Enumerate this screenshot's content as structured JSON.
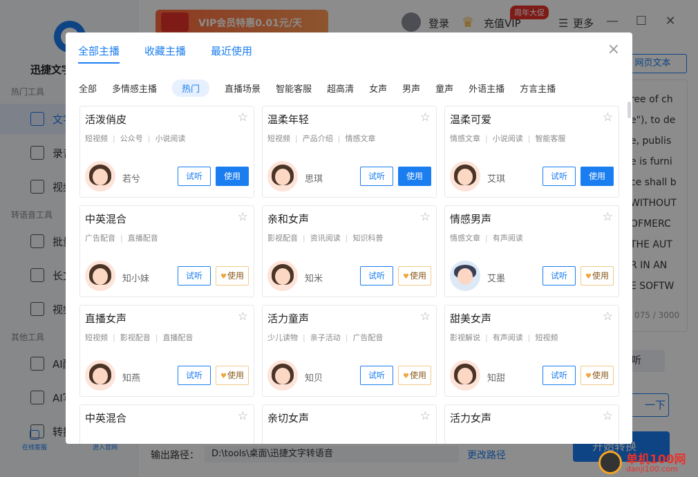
{
  "app": {
    "name": "迅捷文字转语音"
  },
  "sidebar": {
    "sections": [
      "热门工具",
      "转语音工具",
      "其他工具"
    ],
    "items": [
      {
        "label": "文字转语音"
      },
      {
        "label": "录音转文字"
      },
      {
        "label": "视频转文字"
      },
      {
        "label": "批量转换"
      },
      {
        "label": "长文本"
      },
      {
        "label": "视频配音"
      },
      {
        "label": "AI配音"
      },
      {
        "label": "AI写作"
      },
      {
        "label": "转换记录"
      }
    ],
    "bottom_links": [
      "在线客服",
      "进入官网"
    ]
  },
  "topbar": {
    "vip_banner": "VIP会员特惠0.01元/天",
    "login": "登录",
    "recharge_vip": "充值VIP",
    "anniversary": "周年大促",
    "more": "更多",
    "minimize": "—",
    "maximize": "☐",
    "close": "✕"
  },
  "main": {
    "web_text_button": "网页文本",
    "text_lines": [
      "ree of ch",
      "e\"), to de",
      "e, publis",
      "e is furni",
      "ce shall b",
      "WITHOUT",
      "OFMERC",
      "THE AUT",
      "R IN AN",
      "E SOFTW"
    ],
    "counter": "075 / 3000",
    "listen_label": "听",
    "next_label": "一下",
    "start_convert": "开始转换",
    "output_label": "输出路径：",
    "output_path": "D:\\tools\\桌面\\迅捷文字转语音",
    "change_path": "更改路径"
  },
  "modal": {
    "tabs": [
      "全部主播",
      "收藏主播",
      "最近使用"
    ],
    "active_tab": 0,
    "close_icon": "×",
    "filters": [
      "全部",
      "多情感主播",
      "热门",
      "直播场景",
      "智能客服",
      "超高清",
      "女声",
      "男声",
      "童声",
      "外语主播",
      "方言主播"
    ],
    "active_filter": 2,
    "try_label": "试听",
    "use_label": "使用",
    "cards": [
      {
        "title": "活泼俏皮",
        "tags": [
          "短视频",
          "公众号",
          "小说阅读"
        ],
        "speaker": "若兮",
        "vip": false,
        "gender": "f"
      },
      {
        "title": "温柔年轻",
        "tags": [
          "短视频",
          "产品介绍",
          "情感文章"
        ],
        "speaker": "思琪",
        "vip": false,
        "gender": "f"
      },
      {
        "title": "温柔可爱",
        "tags": [
          "情感文章",
          "小说阅读",
          "智能客服"
        ],
        "speaker": "艾琪",
        "vip": false,
        "gender": "f"
      },
      {
        "title": "中英混合",
        "tags": [
          "广告配音",
          "直播配音"
        ],
        "speaker": "知小妹",
        "vip": true,
        "gender": "f"
      },
      {
        "title": "亲和女声",
        "tags": [
          "影视配音",
          "资讯阅读",
          "知识科普"
        ],
        "speaker": "知米",
        "vip": true,
        "gender": "f"
      },
      {
        "title": "情感男声",
        "tags": [
          "情感文章",
          "有声阅读"
        ],
        "speaker": "艾墨",
        "vip": true,
        "gender": "m"
      },
      {
        "title": "直播女声",
        "tags": [
          "短视频",
          "影视配音",
          "直播配音"
        ],
        "speaker": "知燕",
        "vip": true,
        "gender": "f"
      },
      {
        "title": "活力童声",
        "tags": [
          "少儿读物",
          "亲子活动",
          "广告配音"
        ],
        "speaker": "知贝",
        "vip": true,
        "gender": "f"
      },
      {
        "title": "甜美女声",
        "tags": [
          "影视解说",
          "有声阅读",
          "短视频"
        ],
        "speaker": "知甜",
        "vip": true,
        "gender": "f"
      },
      {
        "title": "中英混合",
        "tags": [],
        "speaker": "",
        "vip": false,
        "gender": "f"
      },
      {
        "title": "亲切女声",
        "tags": [],
        "speaker": "",
        "vip": false,
        "gender": "f"
      },
      {
        "title": "活力女声",
        "tags": [],
        "speaker": "",
        "vip": false,
        "gender": "f"
      }
    ]
  },
  "watermark": {
    "title": "单机100网",
    "url": "danji100.com"
  },
  "colors": {
    "accent": "#1a7df0",
    "vip_red": "#e8322b",
    "vip_gold": "#f1a43b"
  }
}
